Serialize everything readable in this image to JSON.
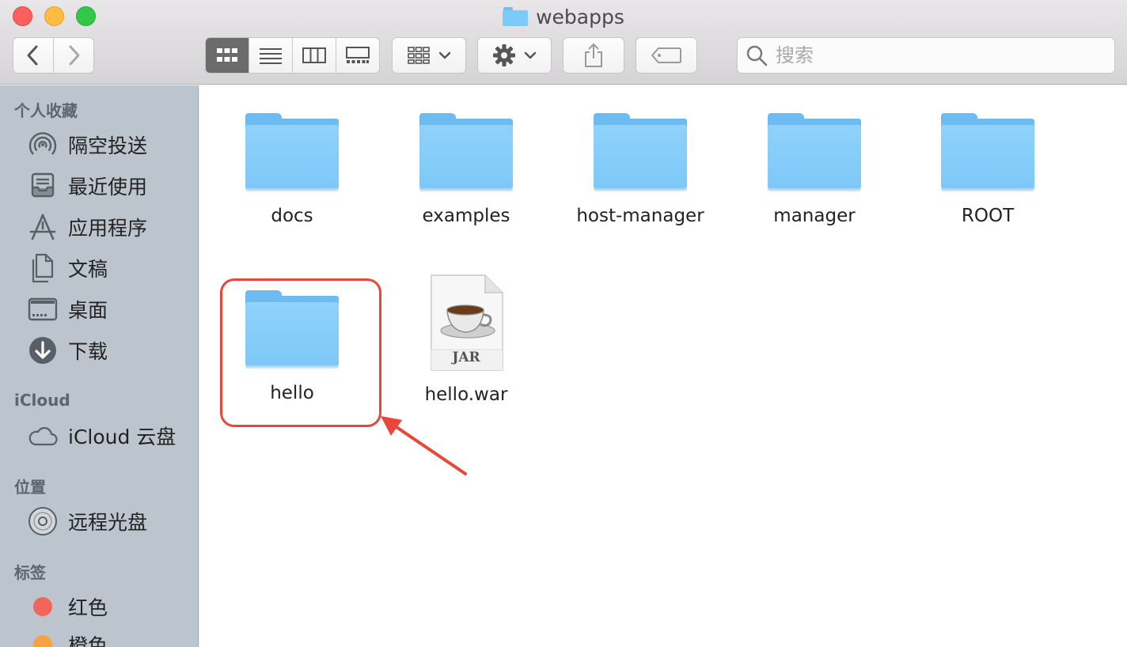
{
  "window": {
    "title": "webapps",
    "title_icon": "folder-icon"
  },
  "toolbar": {
    "back": "chevron-left-icon",
    "forward": "chevron-right-icon",
    "view_modes": [
      "icon-view",
      "list-view",
      "column-view",
      "gallery-view"
    ],
    "active_view": "icon-view",
    "group_button": "grid-arrange-icon",
    "action_button": "gear-icon",
    "share_button": "share-icon",
    "tag_button": "tag-icon"
  },
  "search": {
    "placeholder": "搜索",
    "value": ""
  },
  "sidebar": {
    "sections": [
      {
        "title": "个人收藏",
        "items": [
          {
            "label": "隔空投送",
            "icon": "airdrop-icon"
          },
          {
            "label": "最近使用",
            "icon": "recents-icon"
          },
          {
            "label": "应用程序",
            "icon": "applications-icon"
          },
          {
            "label": "文稿",
            "icon": "documents-icon"
          },
          {
            "label": "桌面",
            "icon": "desktop-icon"
          },
          {
            "label": "下载",
            "icon": "downloads-icon"
          }
        ]
      },
      {
        "title": "iCloud",
        "items": [
          {
            "label": "iCloud 云盘",
            "icon": "cloud-icon"
          }
        ]
      },
      {
        "title": "位置",
        "items": [
          {
            "label": "远程光盘",
            "icon": "disc-icon"
          }
        ]
      },
      {
        "title": "标签",
        "items": [
          {
            "label": "红色",
            "icon": "tag-dot",
            "color": "#f0665a"
          },
          {
            "label": "橙色",
            "icon": "tag-dot",
            "color": "#f5a244"
          }
        ]
      }
    ]
  },
  "files": [
    {
      "name": "docs",
      "type": "folder"
    },
    {
      "name": "examples",
      "type": "folder"
    },
    {
      "name": "host-manager",
      "type": "folder"
    },
    {
      "name": "manager",
      "type": "folder"
    },
    {
      "name": "ROOT",
      "type": "folder"
    },
    {
      "name": "hello",
      "type": "folder",
      "highlighted": true
    },
    {
      "name": "hello.war",
      "type": "jar",
      "badge": "JAR"
    }
  ],
  "annotation": {
    "color": "#e8473a",
    "target": "hello"
  }
}
